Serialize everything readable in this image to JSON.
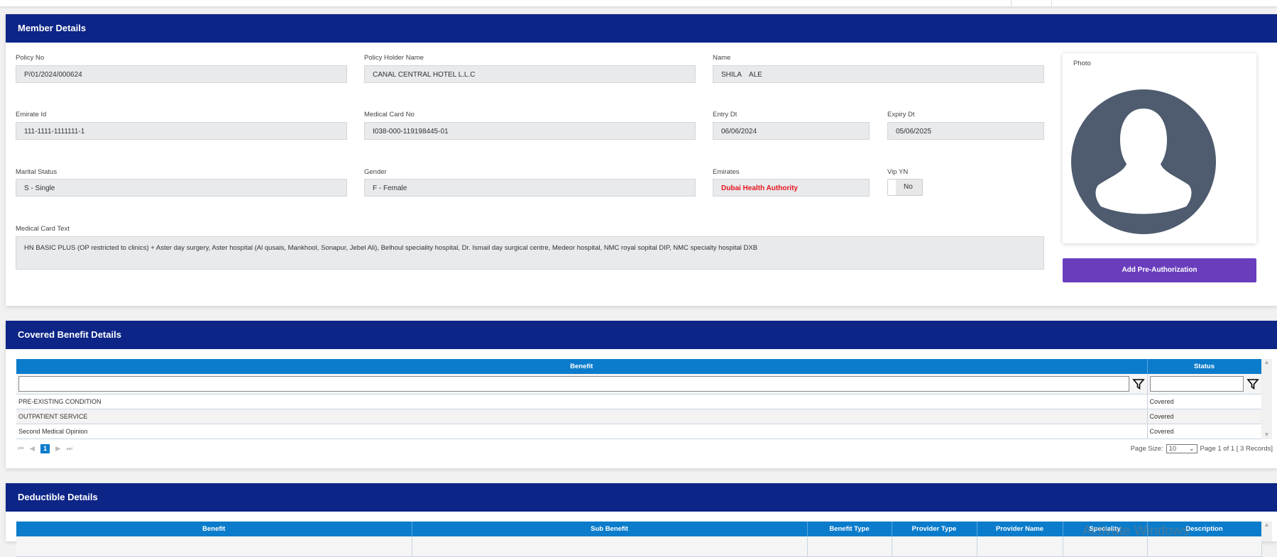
{
  "member": {
    "title": "Member Details",
    "policy_no": {
      "label": "Policy No",
      "value": "P/01/2024/000624"
    },
    "holder": {
      "label": "Policy Holder Name",
      "value": "CANAL CENTRAL HOTEL L.L.C"
    },
    "name": {
      "label": "Name",
      "value": "SHILA    ALE"
    },
    "emirate_id": {
      "label": "Emirate Id",
      "value": "111-1111-1111111-1"
    },
    "card_no": {
      "label": "Medical Card No",
      "value": "I038-000-119198445-01"
    },
    "entry": {
      "label": "Entry Dt",
      "value": "06/06/2024"
    },
    "expiry": {
      "label": "Expiry Dt",
      "value": "05/06/2025"
    },
    "marital": {
      "label": "Marital Status",
      "value": "S - Single"
    },
    "gender": {
      "label": "Gender",
      "value": "F - Female"
    },
    "emirates": {
      "label": "Emirates",
      "value": "Dubai Health Authority"
    },
    "vip": {
      "label": "Vip YN",
      "value": "No"
    },
    "card_text": {
      "label": "Medical Card Text",
      "value": "HN BASIC PLUS (OP restricted to clinics) + Aster day surgery, Aster hospital (Al qusais, Mankhool, Sonapur, Jebel Ali), Belhoul speciality hospital, Dr. Ismail day surgical centre, Medeor hospital, NMC royal sopital DIP,  NMC specialty hospital DXB"
    },
    "photo_label": "Photo",
    "add_preauth": "Add Pre-Authorization"
  },
  "covered": {
    "title": "Covered Benefit Details",
    "columns": [
      "Benefit",
      "Status"
    ],
    "rows": [
      [
        "PRE-EXISTING CONDITION",
        "Covered"
      ],
      [
        "OUTPATIENT SERVICE",
        "Covered"
      ],
      [
        "Second Medical Opinion",
        "Covered"
      ]
    ],
    "page": "1",
    "page_size_label": "Page Size:",
    "page_size": "10",
    "page_info": "Page 1 of 1 [ 3 Records]"
  },
  "deductible": {
    "title": "Deductible Details",
    "columns": [
      "Benefit",
      "Sub Benefit",
      "Benefit Type",
      "Provider Type",
      "Provider Name",
      "Speciality",
      "Description"
    ]
  },
  "watermark": "Activate Windows",
  "colors": {
    "header": "#0d2587",
    "grid_header": "#0b7ccb",
    "button": "#6a3dbd",
    "emirates_text": "#e8141e"
  }
}
